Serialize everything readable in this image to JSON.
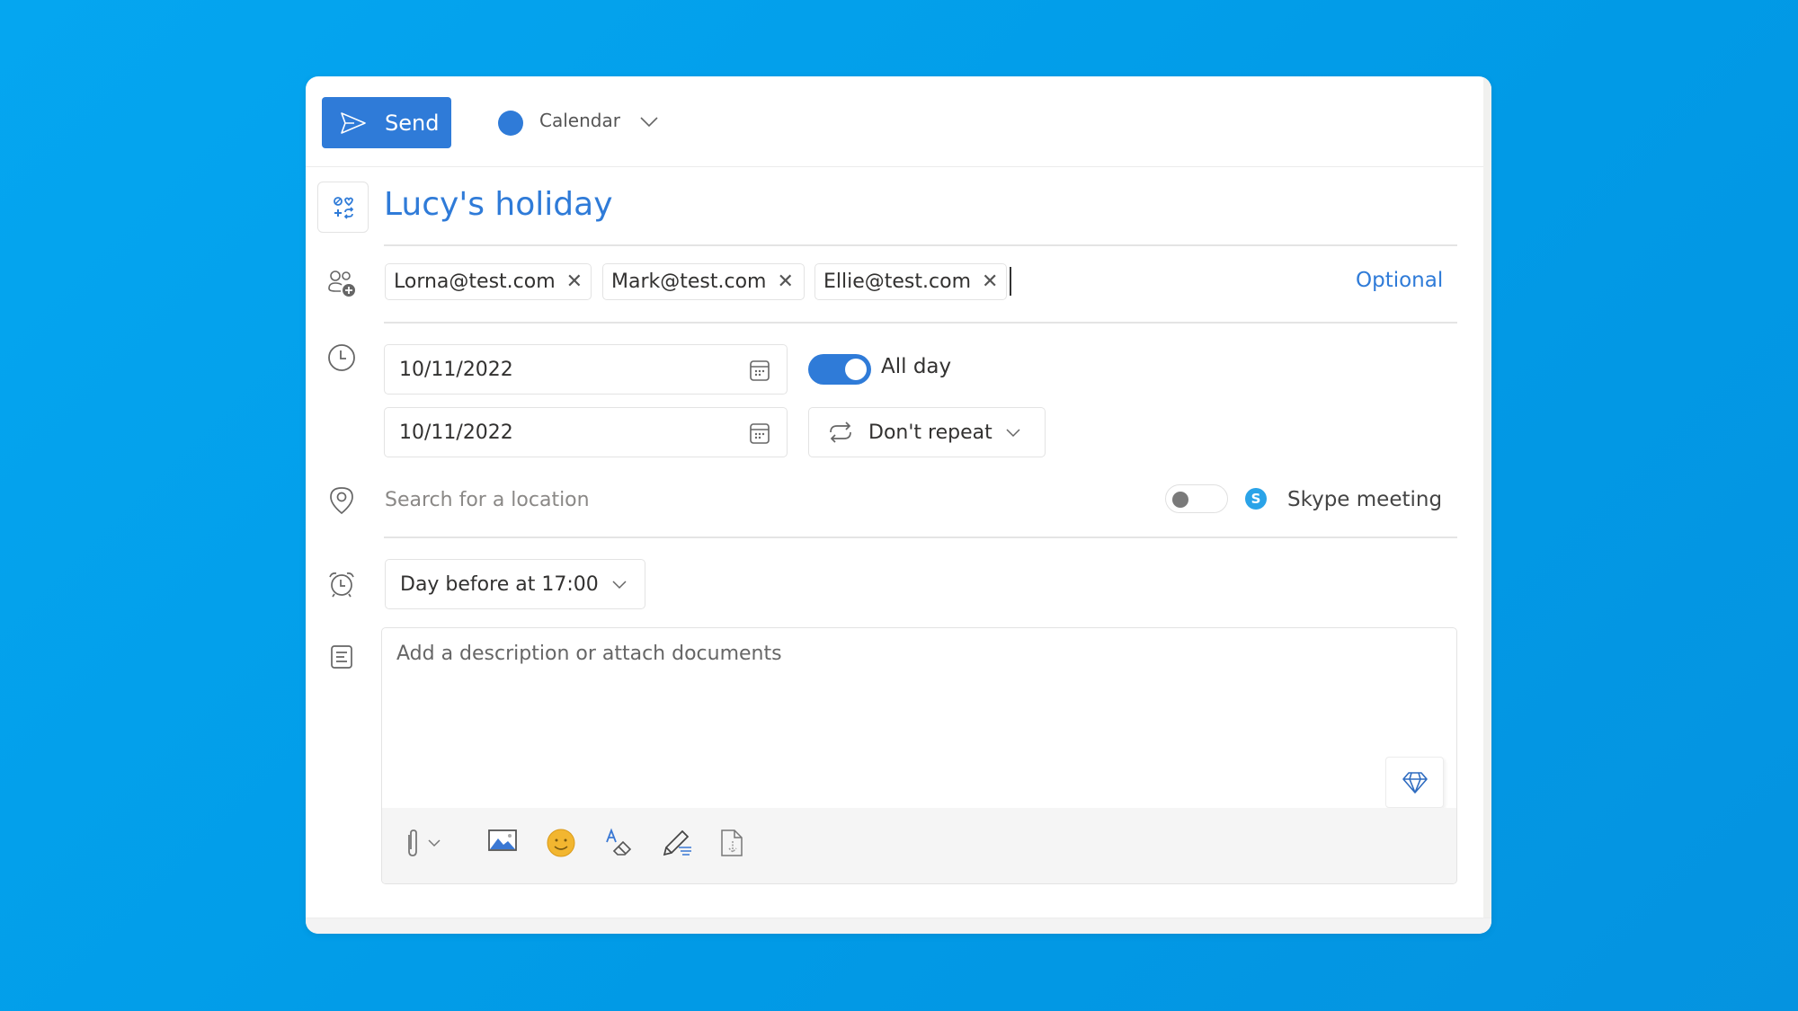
{
  "header": {
    "send_label": "Send",
    "calendar_label": "Calendar",
    "calendar_color": "#2f7bd8"
  },
  "event": {
    "title": "Lucy's holiday"
  },
  "attendees": {
    "chips": [
      {
        "email": "Lorna@test.com"
      },
      {
        "email": "Mark@test.com"
      },
      {
        "email": "Ellie@test.com"
      }
    ],
    "optional_label": "Optional"
  },
  "time": {
    "start_date": "10/11/2022",
    "end_date": "10/11/2022",
    "all_day_label": "All day",
    "all_day_on": true,
    "repeat_label": "Don't repeat"
  },
  "location": {
    "placeholder": "Search for a location",
    "skype_label": "Skype meeting",
    "skype_on": false
  },
  "reminder": {
    "value": "Day before at 17:00"
  },
  "description": {
    "placeholder": "Add a description or attach documents"
  },
  "icons": {
    "send": "send-icon",
    "category": "category-icon",
    "people": "add-people-icon",
    "clock": "clock-icon",
    "calendar": "calendar-icon",
    "repeat": "repeat-icon",
    "location": "location-pin-icon",
    "skype": "skype-icon",
    "alarm": "alarm-icon",
    "notes": "notes-icon",
    "attach": "paperclip-icon",
    "image": "image-icon",
    "emoji": "emoji-icon",
    "format": "format-text-icon",
    "signature": "signature-pen-icon",
    "save_doc": "document-download-icon",
    "premium": "diamond-icon"
  },
  "colors": {
    "accent": "#2f7bd8",
    "background": "#05a6f0"
  }
}
